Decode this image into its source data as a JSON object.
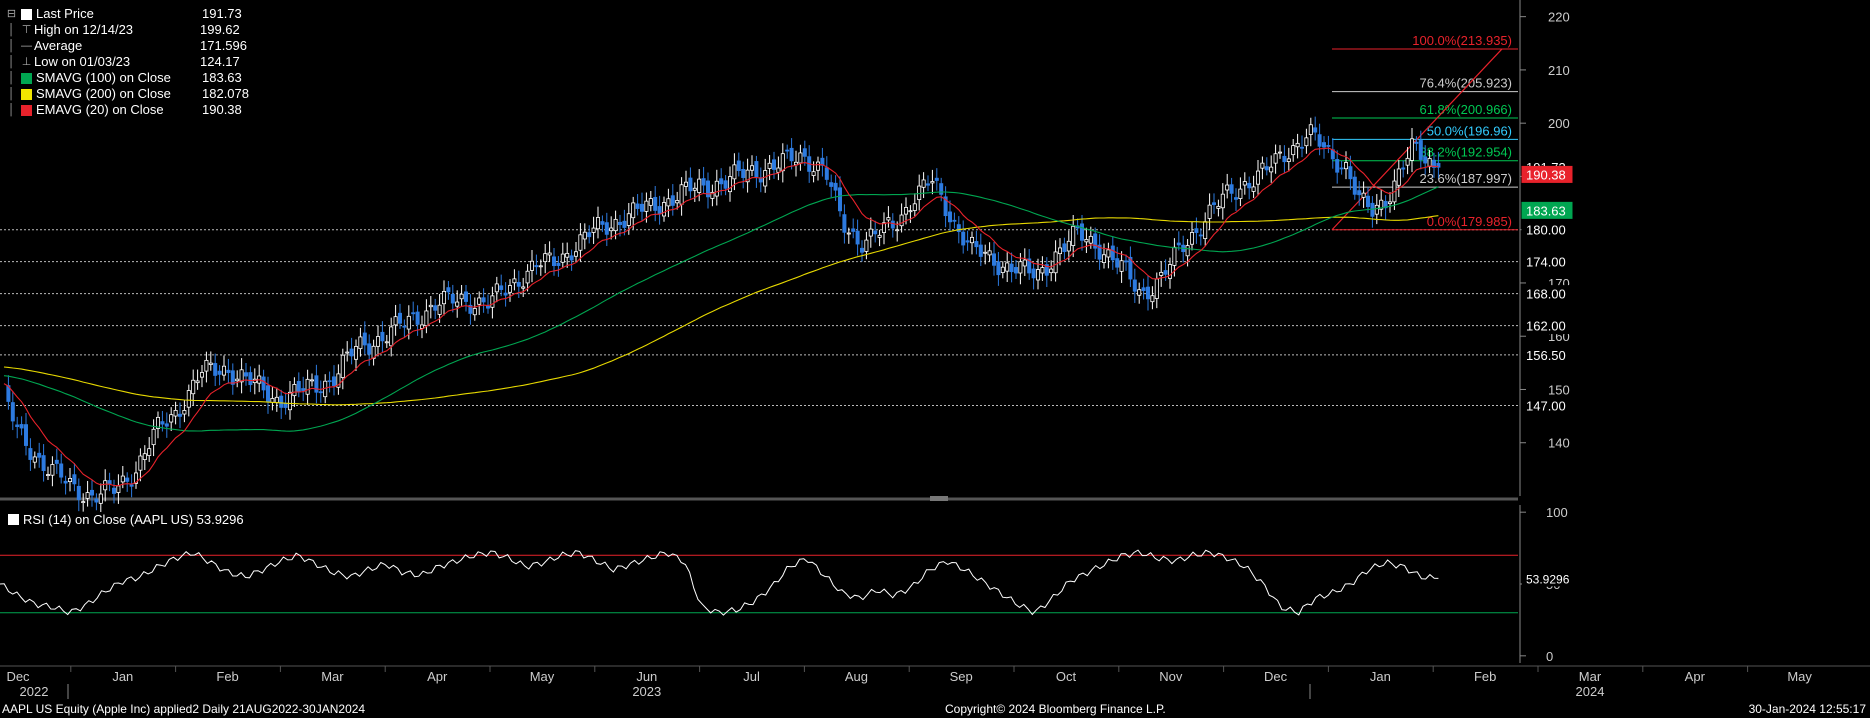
{
  "legend": {
    "items": [
      {
        "label": "Last Price",
        "value": "191.73",
        "swatch": "#ffffff",
        "marker": "box"
      },
      {
        "label": "High on 12/14/23",
        "value": "199.62",
        "swatch": "",
        "marker": "high"
      },
      {
        "label": "Average",
        "value": "171.596",
        "swatch": "",
        "marker": "avg"
      },
      {
        "label": "Low on 01/03/23",
        "value": "124.17",
        "swatch": "",
        "marker": "low"
      },
      {
        "label": "SMAVG (100)  on Close",
        "value": "183.63",
        "swatch": "#00a651",
        "marker": "box"
      },
      {
        "label": "SMAVG (200)  on Close",
        "value": "182.078",
        "swatch": "#f2e600",
        "marker": "box"
      },
      {
        "label": "EMAVG (20)  on Close",
        "value": "190.38",
        "swatch": "#e8222b",
        "marker": "box"
      }
    ]
  },
  "rsi_legend": {
    "label": "RSI (14)  on Close (AAPL US) 53.9296"
  },
  "footer": {
    "left": "AAPL US Equity (Apple Inc) applied2  Daily 21AUG2022-30JAN2024",
    "center": "Copyright© 2024 Bloomberg Finance L.P.",
    "right": "30-Jan-2024 12:55:17"
  },
  "colors": {
    "background": "#000000",
    "up_candle": "#ffffff",
    "down_candle": "#2d7be0",
    "sma100": "#00a651",
    "sma200": "#e6d800",
    "ema20": "#e8222b",
    "fib_line": "#cccccc",
    "rsi_upper": "#e8222b",
    "rsi_lower": "#00a651"
  },
  "chart_data": [
    {
      "type": "candlestick",
      "title": "",
      "ylim": [
        130,
        222
      ],
      "y_ticks": [
        140,
        150,
        160,
        170,
        180,
        190,
        200,
        210,
        220
      ],
      "grid": false,
      "legend_placement": "top-left",
      "x_months": [
        "Dec",
        "Jan",
        "Feb",
        "Mar",
        "Apr",
        "May",
        "Jun",
        "Jul",
        "Aug",
        "Sep",
        "Oct",
        "Nov",
        "Dec",
        "Jan",
        "Feb",
        "Mar",
        "Apr",
        "May"
      ],
      "x_years": [
        {
          "label": "2022",
          "month_index": 0
        },
        {
          "label": "2023",
          "month_index": 6
        },
        {
          "label": "2024",
          "month_index": 15
        }
      ],
      "close_path": [
        [
          "Dec",
          148
        ],
        [
          "Dec",
          142
        ],
        [
          "Dec",
          136
        ],
        [
          "Dec",
          132
        ],
        [
          "Jan",
          130
        ],
        [
          "Jan",
          131
        ],
        [
          "Jan",
          135
        ],
        [
          "Jan",
          142
        ],
        [
          "Jan",
          146
        ],
        [
          "Feb",
          153
        ],
        [
          "Feb",
          154
        ],
        [
          "Feb",
          151
        ],
        [
          "Feb",
          148
        ],
        [
          "Mar",
          150
        ],
        [
          "Mar",
          152
        ],
        [
          "Mar",
          158
        ],
        [
          "Mar",
          160
        ],
        [
          "Apr",
          163
        ],
        [
          "Apr",
          166
        ],
        [
          "Apr",
          167
        ],
        [
          "Apr",
          166
        ],
        [
          "May",
          170
        ],
        [
          "May",
          173
        ],
        [
          "May",
          174
        ],
        [
          "May",
          177
        ],
        [
          "May",
          180
        ],
        [
          "Jun",
          182
        ],
        [
          "Jun",
          184
        ],
        [
          "Jun",
          186
        ],
        [
          "Jun",
          188
        ],
        [
          "Jul",
          189
        ],
        [
          "Jul",
          191
        ],
        [
          "Jul",
          192
        ],
        [
          "Jul",
          194
        ],
        [
          "Aug",
          191
        ],
        [
          "Aug",
          181
        ],
        [
          "Aug",
          178
        ],
        [
          "Aug",
          179
        ],
        [
          "Aug",
          181
        ],
        [
          "Aug",
          186
        ],
        [
          "Sep",
          189
        ],
        [
          "Sep",
          182
        ],
        [
          "Sep",
          176
        ],
        [
          "Sep",
          174
        ],
        [
          "Sep",
          173
        ],
        [
          "Oct",
          171
        ],
        [
          "Oct",
          176
        ],
        [
          "Oct",
          179
        ],
        [
          "Oct",
          177
        ],
        [
          "Oct",
          173
        ],
        [
          "Nov",
          168
        ],
        [
          "Nov",
          171
        ],
        [
          "Nov",
          177
        ],
        [
          "Nov",
          182
        ],
        [
          "Nov",
          186
        ],
        [
          "Dec",
          189
        ],
        [
          "Dec",
          191
        ],
        [
          "Dec",
          195
        ],
        [
          "Dec",
          198
        ],
        [
          "Dec",
          194
        ],
        [
          "Jan",
          192
        ],
        [
          "Jan",
          185
        ],
        [
          "Jan",
          183
        ],
        [
          "Jan",
          186
        ],
        [
          "Jan",
          191
        ],
        [
          "Jan",
          195
        ],
        [
          "Jan",
          193
        ],
        [
          "Jan",
          191.73
        ]
      ],
      "series": [
        {
          "name": "SMAVG (100)  on Close",
          "last": 183.63
        },
        {
          "name": "SMAVG (200)  on Close",
          "last": 182.078
        },
        {
          "name": "EMAVG (20)  on Close",
          "last": 190.38
        }
      ],
      "fibonacci": {
        "levels": [
          {
            "label": "100.0%(213.935)",
            "value": 213.935,
            "color": "#e8222b"
          },
          {
            "label": "76.4%(205.923)",
            "value": 205.923,
            "color": "#cccccc"
          },
          {
            "label": "61.8%(200.966)",
            "value": 200.966,
            "color": "#00c853"
          },
          {
            "label": "50.0%(196.96)",
            "value": 196.96,
            "color": "#33ccff"
          },
          {
            "label": "38.2%(192.954)",
            "value": 192.954,
            "color": "#00c853"
          },
          {
            "label": "23.6%(187.997)",
            "value": 187.997,
            "color": "#cccccc"
          },
          {
            "label": "0.0%(179.985)",
            "value": 179.985,
            "color": "#e8222b"
          }
        ]
      },
      "horizontal_levels": [
        180.0,
        174.0,
        168.0,
        162.0,
        156.5,
        147.0
      ],
      "right_labels": [
        {
          "text": "191.73",
          "value": 191.73,
          "bg": "#000000",
          "fg": "#ffffff"
        },
        {
          "text": "190.38",
          "value": 190.38,
          "bg": "#e8222b",
          "fg": "#ffffff"
        },
        {
          "text": "183.63",
          "value": 183.63,
          "bg": "#00a651",
          "fg": "#ffffff"
        },
        {
          "text": "180.00",
          "value": 180.0,
          "bg": "#000000",
          "fg": "#ffffff"
        },
        {
          "text": "174.00",
          "value": 174.0,
          "bg": "#000000",
          "fg": "#ffffff"
        },
        {
          "text": "168.00",
          "value": 168.0,
          "bg": "#000000",
          "fg": "#ffffff"
        },
        {
          "text": "162.00",
          "value": 162.0,
          "bg": "#000000",
          "fg": "#ffffff"
        },
        {
          "text": "156.50",
          "value": 156.5,
          "bg": "#000000",
          "fg": "#ffffff"
        },
        {
          "text": "147.00",
          "value": 147.0,
          "bg": "#000000",
          "fg": "#ffffff"
        }
      ]
    },
    {
      "type": "line",
      "title": "",
      "series_name": "RSI (14)  on Close (AAPL US)",
      "last": 53.9296,
      "last_label": "53.9296",
      "ylim": [
        -5,
        105
      ],
      "y_ticks": [
        0,
        50,
        100
      ],
      "upper_band": 70,
      "lower_band": 30,
      "values": [
        50,
        42,
        36,
        34,
        30,
        36,
        45,
        52,
        55,
        62,
        68,
        72,
        65,
        58,
        55,
        60,
        66,
        70,
        64,
        58,
        55,
        60,
        64,
        58,
        56,
        62,
        66,
        70,
        72,
        68,
        62,
        65,
        70,
        72,
        66,
        60,
        64,
        68,
        72,
        66,
        34,
        30,
        32,
        38,
        48,
        62,
        68,
        56,
        44,
        40,
        46,
        42,
        48,
        60,
        66,
        60,
        52,
        44,
        36,
        30,
        40,
        52,
        58,
        64,
        70,
        72,
        68,
        66,
        70,
        72,
        68,
        62,
        50,
        34,
        30,
        40,
        44,
        50,
        60,
        65,
        62,
        55,
        53.9296
      ]
    }
  ]
}
